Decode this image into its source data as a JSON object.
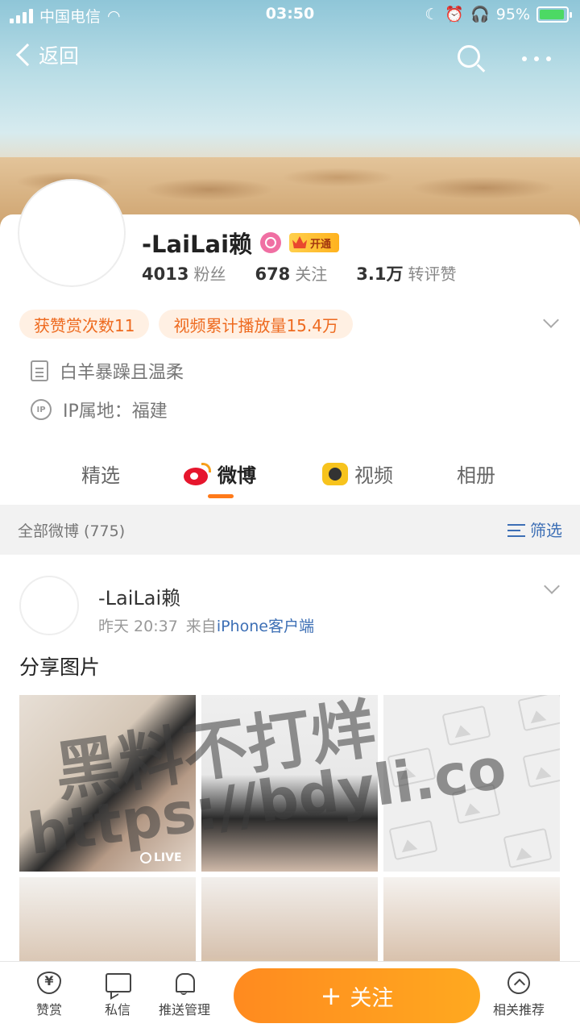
{
  "status_bar": {
    "carrier": "中国电信",
    "time": "03:50",
    "battery": "95%"
  },
  "nav": {
    "back_label": "返回"
  },
  "profile": {
    "name": "-LaiLai赖",
    "vip_badge": "开通",
    "stats": [
      {
        "value": "4013",
        "label": "粉丝"
      },
      {
        "value": "678",
        "label": "关注"
      },
      {
        "value": "3.1万",
        "label": "转评赞"
      }
    ],
    "badges": [
      "获赞赏次数11",
      "视频累计播放量15.4万"
    ],
    "bio": "白羊暴躁且温柔",
    "ip": "IP属地：福建"
  },
  "tabs": [
    {
      "label": "精选",
      "active": false
    },
    {
      "label": "微博",
      "active": true,
      "icon": "weibo-icon"
    },
    {
      "label": "视频",
      "active": false,
      "icon": "video-icon"
    },
    {
      "label": "相册",
      "active": false
    }
  ],
  "filter": {
    "count_label": "全部微博 (775)",
    "button_label": "筛选"
  },
  "post": {
    "author": "-LaiLai赖",
    "time": "昨天 20:37",
    "from_prefix": "来自",
    "source": "iPhone客户端",
    "text": "分享图片",
    "live_label": "LIVE"
  },
  "watermark": {
    "line1": "黑料不打烊",
    "line2": "https://bdyli.co"
  },
  "bottom_bar": {
    "items": [
      "赞赏",
      "私信",
      "推送管理",
      "相关推荐"
    ],
    "follow_label": "关注"
  },
  "colors": {
    "accent": "#ff8a1f",
    "link": "#3d6fb5",
    "badge_text": "#ee6a1f"
  }
}
